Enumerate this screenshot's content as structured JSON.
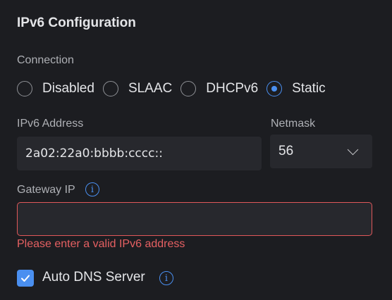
{
  "title": "IPv6 Configuration",
  "connection": {
    "label": "Connection",
    "options": [
      "Disabled",
      "SLAAC",
      "DHCPv6",
      "Static"
    ],
    "selected": "Static"
  },
  "ipv6_address": {
    "label": "IPv6 Address",
    "value": "2a02:22a0:bbbb:cccc::"
  },
  "netmask": {
    "label": "Netmask",
    "value": "56"
  },
  "gateway": {
    "label": "Gateway IP",
    "value": "",
    "error": "Please enter a valid IPv6 address",
    "info_icon": "info-icon"
  },
  "auto_dns": {
    "label": "Auto DNS Server",
    "checked": true,
    "info_icon": "info-icon"
  },
  "colors": {
    "accent": "#4a8ff0",
    "error": "#e0585a",
    "background": "#1c1d21",
    "input_background": "#27282d"
  }
}
